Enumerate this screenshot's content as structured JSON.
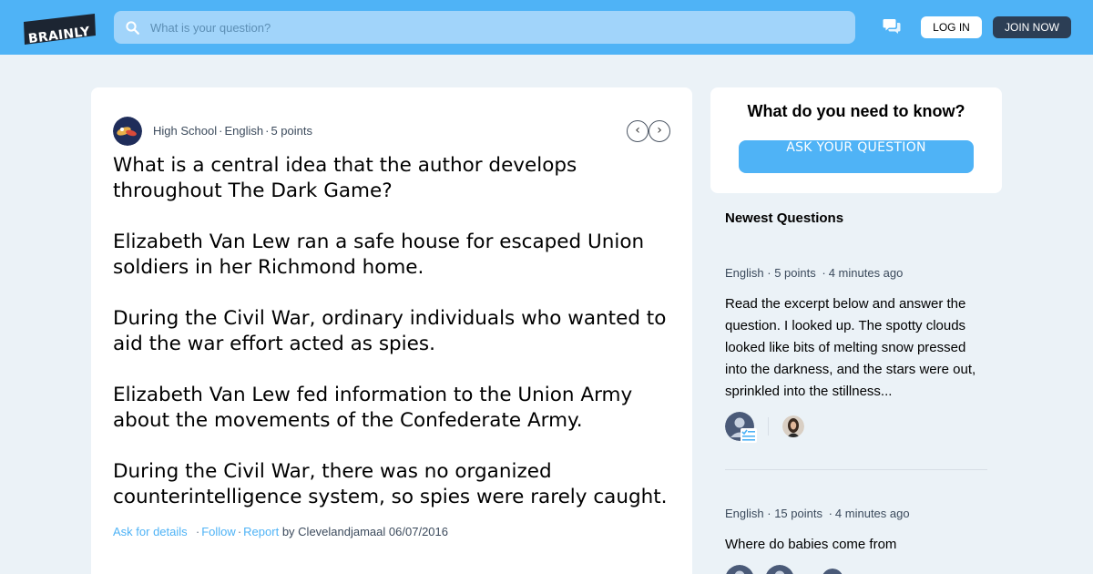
{
  "header": {
    "logo_text": "BRAINLY",
    "search_placeholder": "What is your question?",
    "login_label": "LOG IN",
    "join_label": "JOIN NOW",
    "icons": [
      "search-icon",
      "messages-icon"
    ],
    "colors": {
      "bar": "#4fb3f6",
      "join_button": "#2c3e55",
      "accent": "#4fb3f6"
    }
  },
  "question": {
    "level": "High School",
    "subject": "English",
    "points": "5 points",
    "paragraphs": [
      "What is a central idea that the author develops throughout The Dark Game?",
      "Elizabeth Van Lew ran a safe house for escaped Union soldiers in her Richmond home.",
      "During the Civil War, ordinary individuals who wanted to aid the war effort acted as spies.",
      "Elizabeth Van Lew fed information to the Union Army about the movements of the Confederate Army.",
      "During the Civil War, there was no organized counterintelligence system, so spies were rarely caught."
    ],
    "actions": {
      "ask_for_details": "Ask for details",
      "follow": "Follow",
      "report": "Report",
      "by_label": "by",
      "author": "Clevelandjamaal",
      "date": "06/07/2016"
    }
  },
  "sidebar": {
    "ask_title": "What do you need to know?",
    "ask_button": "ASK YOUR QUESTION",
    "newest_title": "Newest Questions",
    "newest": [
      {
        "subject": "English",
        "points": "5 points",
        "time": "4 minutes ago",
        "text": "Read the excerpt below and answer the question. I looked up. The spotty clouds looked like bits of melting snow pressed into the darkness, and the stars were out, sprinkled into the stillness..."
      },
      {
        "subject": "English",
        "points": "15 points",
        "time": "4 minutes ago",
        "text": "Where do babies come from"
      }
    ]
  }
}
